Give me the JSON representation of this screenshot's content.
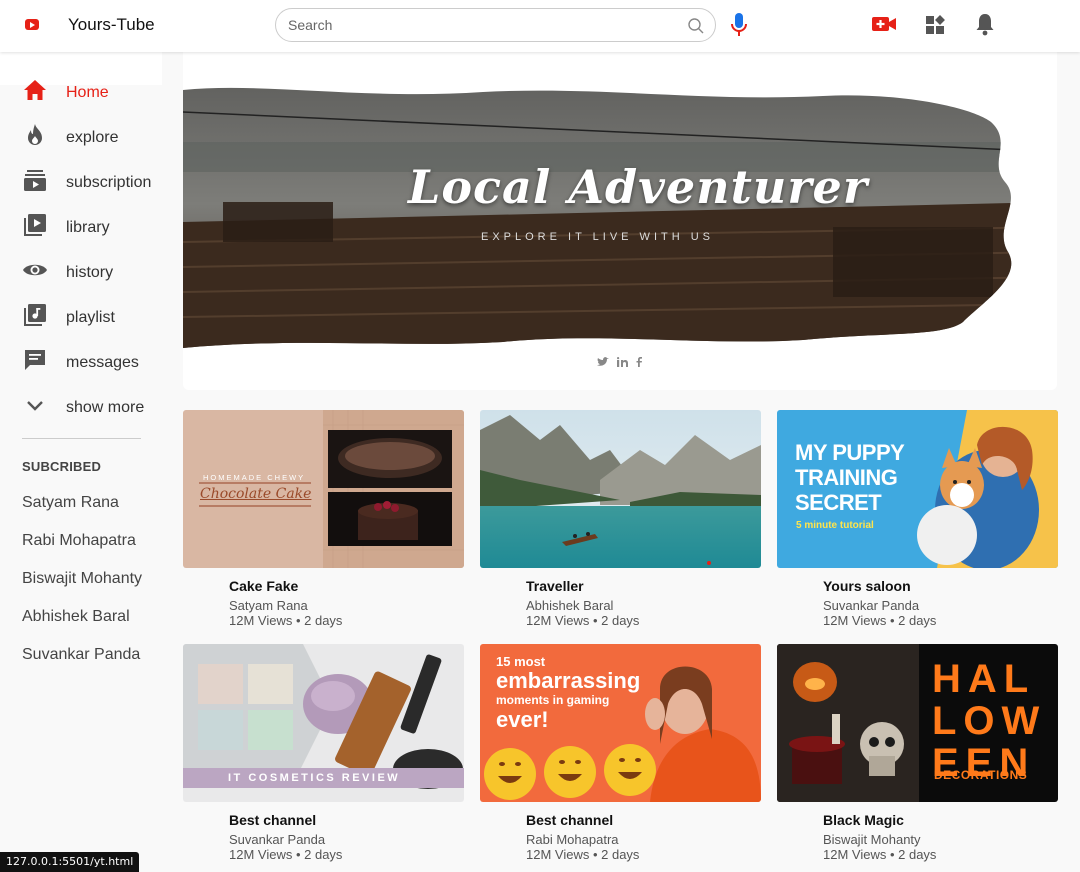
{
  "app": {
    "title": "Yours-Tube",
    "brand_color": "#e62117"
  },
  "search": {
    "placeholder": "Search",
    "value": ""
  },
  "header_icons": [
    "youtube-logo-icon",
    "search-icon",
    "mic-icon",
    "video-add-icon",
    "apps-icon",
    "bell-icon"
  ],
  "sidebar": {
    "items": [
      {
        "label": "Home",
        "icon": "home-icon",
        "active": true
      },
      {
        "label": "explore",
        "icon": "flame-icon"
      },
      {
        "label": "subscription",
        "icon": "subscription-icon"
      },
      {
        "label": "library",
        "icon": "library-icon"
      },
      {
        "label": "history",
        "icon": "eye-icon"
      },
      {
        "label": "playlist",
        "icon": "playlist-icon"
      },
      {
        "label": "messages",
        "icon": "message-icon"
      },
      {
        "label": "show more",
        "icon": "chevron-down-icon"
      }
    ],
    "subscribed_title": "SUBCRIBED",
    "subscribed": [
      "Satyam Rana",
      "Rabi Mohapatra",
      "Biswajit Mohanty",
      "Abhishek Baral",
      "Suvankar Panda"
    ]
  },
  "banner": {
    "title": "Local Adventurer",
    "subtitle": "EXPLORE IT LIVE WITH US",
    "social": [
      "twitter-icon",
      "linkedin-icon",
      "facebook-icon"
    ]
  },
  "videos": [
    {
      "title": "Cake Fake",
      "channel": "Satyam Rana",
      "meta": "12M Views • 2 days",
      "thumb": {
        "line1": "HOMEMADE CHEWY",
        "line2": "Chocolate Cake"
      }
    },
    {
      "title": "Traveller",
      "channel": "Abhishek Baral",
      "meta": "12M Views • 2 days",
      "thumb": {}
    },
    {
      "title": "Yours saloon",
      "channel": "Suvankar Panda",
      "meta": "12M Views • 2 days",
      "thumb": {
        "line1": "MY PUPPY",
        "line2": "TRAINING",
        "line3": "SECRET",
        "line4": "5 minute tutorial"
      }
    },
    {
      "title": "Best channel",
      "channel": "Suvankar Panda",
      "meta": "12M Views • 2 days",
      "thumb": {
        "line1": "IT COSMETICS REVIEW"
      }
    },
    {
      "title": "Best channel",
      "channel": "Rabi Mohapatra",
      "meta": "12M Views • 2 days",
      "thumb": {
        "line1": "15 most",
        "line2": "embarrassing",
        "line3": "moments in gaming",
        "line4": "ever!"
      }
    },
    {
      "title": "Black Magic",
      "channel": "Biswajit Mohanty",
      "meta": "12M Views • 2 days",
      "thumb": {
        "line1": "HAL",
        "line2": "LOW",
        "line3": "EEN",
        "line4": "DECORATIONS"
      }
    }
  ],
  "status_bar": {
    "url": "127.0.0.1:5501/yt.html"
  }
}
